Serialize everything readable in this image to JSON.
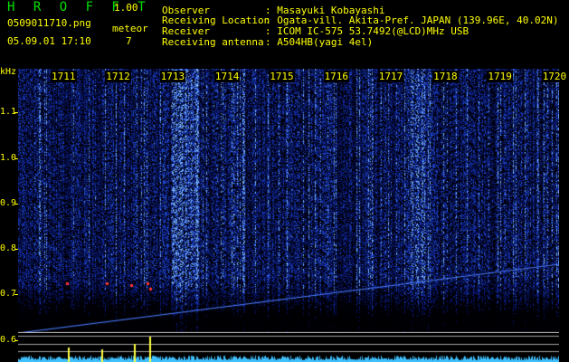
{
  "header": {
    "app_name": "H R O F F T",
    "version": "1.00",
    "filename": "0509011710.png",
    "datetime": "05.09.01 17:10",
    "meteor_label": "meteor",
    "meteor_count": "7",
    "observer_label": "Observer",
    "observer_value": ": Masayuki Kobayashi",
    "location_label": "Receiving Location",
    "location_value": ": Ogata-vill. Akita-Pref. JAPAN (139.96E, 40.02N)",
    "receiver_label": "Receiver",
    "receiver_value": ": ICOM IC-575 53.7492(@LCD)MHz USB",
    "antenna_label": "Receiving antenna",
    "antenna_value": ": A504HB(yagi 4el)"
  },
  "axis": {
    "unit": "kHz",
    "y_ticks": [
      "1.1",
      "1.0",
      "0.9",
      "0.8",
      "0.7",
      "0.6"
    ],
    "time_labels": [
      "1711",
      "1712",
      "1713",
      "1714",
      "1715",
      "1716",
      "1717",
      "1718",
      "1719",
      "1720"
    ]
  },
  "colors": {
    "background": "#000000",
    "text": "#ffff00",
    "title": "#00e000",
    "noise": "#1b2a9a",
    "signal": "#6ab0ff",
    "meteor": "#ff3030",
    "bottom_trace": "#40c0ff"
  }
}
